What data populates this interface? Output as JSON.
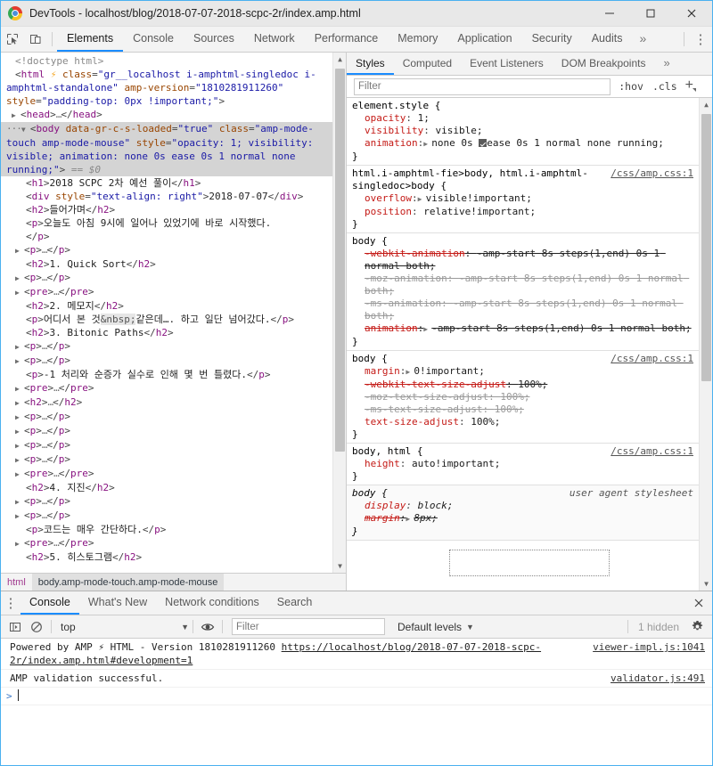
{
  "window": {
    "title": "DevTools - localhost/blog/2018-07-07-2018-scpc-2r/index.amp.html",
    "minimize_label": "–",
    "maximize_label": "□",
    "close_label": "✕"
  },
  "main_tabs": [
    {
      "label": "Elements",
      "active": true
    },
    {
      "label": "Console",
      "active": false
    },
    {
      "label": "Sources",
      "active": false
    },
    {
      "label": "Network",
      "active": false
    },
    {
      "label": "Performance",
      "active": false
    },
    {
      "label": "Memory",
      "active": false
    },
    {
      "label": "Application",
      "active": false
    },
    {
      "label": "Security",
      "active": false
    },
    {
      "label": "Audits",
      "active": false
    }
  ],
  "main_tabs_more": "»",
  "main_menu": "⋮",
  "dom": {
    "lines": [
      {
        "id": "l1",
        "t": "doctype",
        "text": "<!doctype html>"
      },
      {
        "id": "l2",
        "t": "html_open",
        "tag": "html",
        "attr1_name": "class",
        "attr1_val": "\"gr__localhost i-amphtml-singledoc i-amphtml-standalone\"",
        "attr2_name": "amp-version",
        "attr2_val": "\"1810281911260\"",
        "attr3_name": "style",
        "attr3_val": "\"padding-top: 0px !important;\""
      },
      {
        "id": "l3",
        "t": "collapsed",
        "tag": "head"
      },
      {
        "id": "l4",
        "t": "body_sel",
        "tag": "body",
        "attr1_name": "data-gr-c-s-loaded",
        "attr1_val": "\"true\"",
        "attr2_name": "class",
        "attr2_val": "\"amp-mode-touch amp-mode-mouse\"",
        "attr3_name": "style",
        "attr3_val": "\"opacity: 1; visibility: visible; animation: none 0s ease 0s 1 normal none running;\"",
        "marker": "== $0"
      },
      {
        "id": "l5",
        "t": "full",
        "tag": "h1",
        "text": "2018 SCPC 2차 예선 풀이"
      },
      {
        "id": "l6",
        "t": "full_attr",
        "tag": "div",
        "attr1_name": "style",
        "attr1_val": "\"text-align: right\"",
        "text": "2018-07-07"
      },
      {
        "id": "l7",
        "t": "full",
        "tag": "h2",
        "text": "들어가며"
      },
      {
        "id": "l8",
        "t": "full_wrap",
        "tag": "p",
        "text": "오늘도 아침 9시에 일어나 있었기에 바로 시작했다."
      },
      {
        "id": "l9",
        "t": "collapsed",
        "tag": "p"
      },
      {
        "id": "l10",
        "t": "full",
        "tag": "h2",
        "text": "1. Quick Sort"
      },
      {
        "id": "l11",
        "t": "collapsed",
        "tag": "p"
      },
      {
        "id": "l12",
        "t": "collapsed",
        "tag": "pre"
      },
      {
        "id": "l13",
        "t": "full",
        "tag": "h2",
        "text": "2. 메모지"
      },
      {
        "id": "l14",
        "t": "entity",
        "tag": "p",
        "pre": "어디서 본 것",
        "entity": "&nbsp;",
        "post": "같은데…. 하고 일단 넘어갔다."
      },
      {
        "id": "l15",
        "t": "full",
        "tag": "h2",
        "text": "3. Bitonic Paths"
      },
      {
        "id": "l16",
        "t": "collapsed",
        "tag": "p"
      },
      {
        "id": "l17",
        "t": "collapsed",
        "tag": "p"
      },
      {
        "id": "l18",
        "t": "full",
        "tag": "p",
        "text": "-1 처리와 순증가 실수로 인해 몇 번 틀렸다."
      },
      {
        "id": "l19",
        "t": "collapsed",
        "tag": "pre"
      },
      {
        "id": "l20",
        "t": "collapsed",
        "tag": "h2"
      },
      {
        "id": "l21",
        "t": "collapsed",
        "tag": "p"
      },
      {
        "id": "l22",
        "t": "collapsed",
        "tag": "p"
      },
      {
        "id": "l23",
        "t": "collapsed",
        "tag": "p"
      },
      {
        "id": "l24",
        "t": "collapsed",
        "tag": "p"
      },
      {
        "id": "l25",
        "t": "collapsed",
        "tag": "pre"
      },
      {
        "id": "l26",
        "t": "full",
        "tag": "h2",
        "text": "4. 지진"
      },
      {
        "id": "l27",
        "t": "collapsed",
        "tag": "p"
      },
      {
        "id": "l28",
        "t": "collapsed",
        "tag": "p"
      },
      {
        "id": "l29",
        "t": "full",
        "tag": "p",
        "text": "코드는 매우 간단하다."
      },
      {
        "id": "l30",
        "t": "collapsed",
        "tag": "pre"
      },
      {
        "id": "l31",
        "t": "full",
        "tag": "h2",
        "text": "5. 히스토그램"
      }
    ]
  },
  "breadcrumb": [
    {
      "label": "html",
      "selected": false
    },
    {
      "label": "body.amp-mode-touch.amp-mode-mouse",
      "selected": true
    }
  ],
  "styles": {
    "tabs": [
      {
        "label": "Styles",
        "active": true
      },
      {
        "label": "Computed",
        "active": false
      },
      {
        "label": "Event Listeners",
        "active": false
      },
      {
        "label": "DOM Breakpoints",
        "active": false
      }
    ],
    "tabs_more": "»",
    "filter_placeholder": "Filter",
    "filter_value": "",
    "hov_label": ":hov",
    "cls_label": ".cls",
    "new_rule_label": "+",
    "rules": [
      {
        "selector": "element.style {",
        "origin": "",
        "close": "}",
        "declarations": [
          {
            "prop": "opacity",
            "value": "1;",
            "state": "active"
          },
          {
            "prop": "visibility",
            "value": "visible;",
            "state": "active"
          },
          {
            "prop": "animation",
            "value": "none 0s ease 0s 1 normal none running;",
            "state": "active",
            "expandable": true,
            "checkbox": true
          }
        ]
      },
      {
        "selector": "html.i-amphtml-fie>body, html.i-amphtml-singledoc>body {",
        "origin": "/css/amp.css:1",
        "close": "}",
        "declarations": [
          {
            "prop": "overflow",
            "value": "visible!important;",
            "state": "active",
            "expandable": true
          },
          {
            "prop": "position",
            "value": "relative!important;",
            "state": "active"
          }
        ]
      },
      {
        "selector": "body {",
        "origin": "",
        "close": "}",
        "declarations": [
          {
            "prop": "-webkit-animation",
            "value": "-amp-start 8s steps(1,end) 0s 1 normal both;",
            "state": "overridden"
          },
          {
            "prop": "-moz-animation",
            "value": "-amp-start 8s steps(1,end) 0s 1 normal both;",
            "state": "disabled"
          },
          {
            "prop": "-ms-animation",
            "value": "-amp-start 8s steps(1,end) 0s 1 normal both;",
            "state": "disabled"
          },
          {
            "prop": "animation",
            "value": "-amp-start 8s steps(1,end) 0s 1 normal both;",
            "state": "overridden",
            "expandable": true
          }
        ]
      },
      {
        "selector": "body {",
        "origin": "/css/amp.css:1",
        "close": "}",
        "declarations": [
          {
            "prop": "margin",
            "value": "0!important;",
            "state": "active",
            "expandable": true
          },
          {
            "prop": "-webkit-text-size-adjust",
            "value": "100%;",
            "state": "overridden"
          },
          {
            "prop": "-moz-text-size-adjust",
            "value": "100%;",
            "state": "disabled"
          },
          {
            "prop": "-ms-text-size-adjust",
            "value": "100%;",
            "state": "disabled"
          },
          {
            "prop": "text-size-adjust",
            "value": "100%;",
            "state": "active"
          }
        ]
      },
      {
        "selector": "body, html {",
        "origin": "/css/amp.css:1",
        "close": "}",
        "declarations": [
          {
            "prop": "height",
            "value": "auto!important;",
            "state": "active"
          }
        ]
      },
      {
        "selector": "body {",
        "origin": "user agent stylesheet",
        "origin_ua": true,
        "close": "}",
        "declarations": [
          {
            "prop": "display",
            "value": "block;",
            "state": "active"
          },
          {
            "prop": "margin",
            "value": "8px;",
            "state": "overridden",
            "expandable": true
          }
        ]
      }
    ]
  },
  "drawer": {
    "menu_icon": "⋮",
    "tabs": [
      {
        "label": "Console",
        "active": true
      },
      {
        "label": "What's New",
        "active": false
      },
      {
        "label": "Network conditions",
        "active": false
      },
      {
        "label": "Search",
        "active": false
      }
    ],
    "close_label": "✕",
    "toolbar": {
      "context_value": "top",
      "filter_placeholder": "Filter",
      "filter_value": "",
      "levels_label": "Default levels",
      "hidden_label": "1 hidden"
    },
    "messages": [
      {
        "pre": "Powered by AMP ⚡ HTML - Version 1810281911260 ",
        "link": "https://localhost/blog/2018-07-07-2018-scpc-2r/index.amp.html#development=1",
        "source": "viewer-impl.js:1041"
      },
      {
        "pre": "AMP validation successful.",
        "link": "",
        "source": "validator.js:491"
      }
    ],
    "prompt": ">"
  },
  "colors": {
    "accent": "#1a8cff",
    "tagname": "#881280",
    "attrname": "#994500",
    "attrval": "#1a1aa6",
    "prop": "#c41a16",
    "selected_row": "#d4d4d4",
    "titlebar": "#e8e8e8"
  }
}
